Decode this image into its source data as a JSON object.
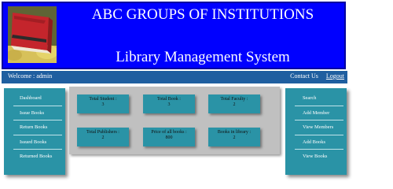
{
  "header": {
    "institution": "ABC GROUPS OF INSTITUTIONS",
    "system_title": "Library Management System",
    "logo_icon": "books-logo"
  },
  "topbar": {
    "welcome": "Welcome : admin",
    "contact": "Contact Us",
    "logout": "Logout"
  },
  "left_menu": [
    "Dashboard",
    "Issue Books",
    "Return Books",
    "Issued Books",
    "Returned Books"
  ],
  "right_menu": [
    "Search",
    "Add Member",
    "View Members",
    "Add Books",
    "View Books"
  ],
  "stats": [
    {
      "label": "Total Student :",
      "value": "3"
    },
    {
      "label": "Total Book :",
      "value": "3"
    },
    {
      "label": "Total Faculty :",
      "value": "2"
    },
    {
      "label": "Total Publishers :",
      "value": "2"
    },
    {
      "label": "Price of all books :",
      "value": "800"
    },
    {
      "label": "Books in library :",
      "value": "2"
    }
  ],
  "colors": {
    "header_bg": "#0000ff",
    "topbar_bg": "#1f5fa0",
    "panel_teal": "#2a93a6",
    "main_bg": "#c0c0c0"
  }
}
